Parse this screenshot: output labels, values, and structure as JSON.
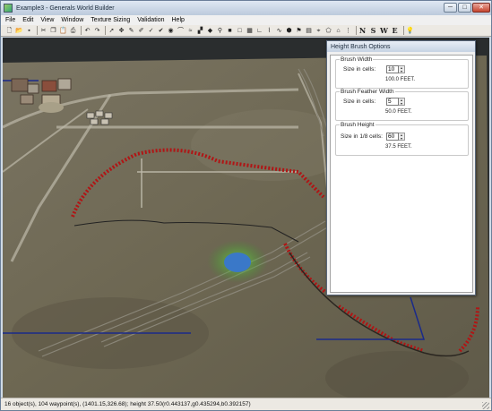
{
  "window": {
    "title": "Example3 - Generals World Builder"
  },
  "window_buttons": {
    "minimize": "─",
    "maximize": "□",
    "close": "✕"
  },
  "menu": [
    "File",
    "Edit",
    "View",
    "Window",
    "Texture Sizing",
    "Validation",
    "Help"
  ],
  "toolbar_letters": [
    "N",
    "S",
    "W",
    "E"
  ],
  "dialog": {
    "title": "Height Brush Options",
    "width_group": {
      "title": "Brush Width",
      "label": "Size in cells:",
      "value": "10",
      "feet": "100.0 FEET."
    },
    "feather_group": {
      "title": "Brush Feather Width",
      "label": "Size in cells:",
      "value": "5",
      "feet": "50.0 FEET."
    },
    "height_group": {
      "title": "Brush Height",
      "label": "Size in 1/8 cells:",
      "value": "60",
      "feet": "37.5 FEET."
    }
  },
  "status": "16 object(s), 104 waypoint(s), (1401.15,326.68); height 37.50(r0.443137,g0.435294,b0.392157)",
  "colors": {
    "terrain": "#6b6450",
    "road": "#bcb8a8",
    "cliff_marker": "#b01515",
    "boundary": "#1a2a8a",
    "water_blob": "#3a78c8",
    "glow": "#5bbf3a"
  }
}
